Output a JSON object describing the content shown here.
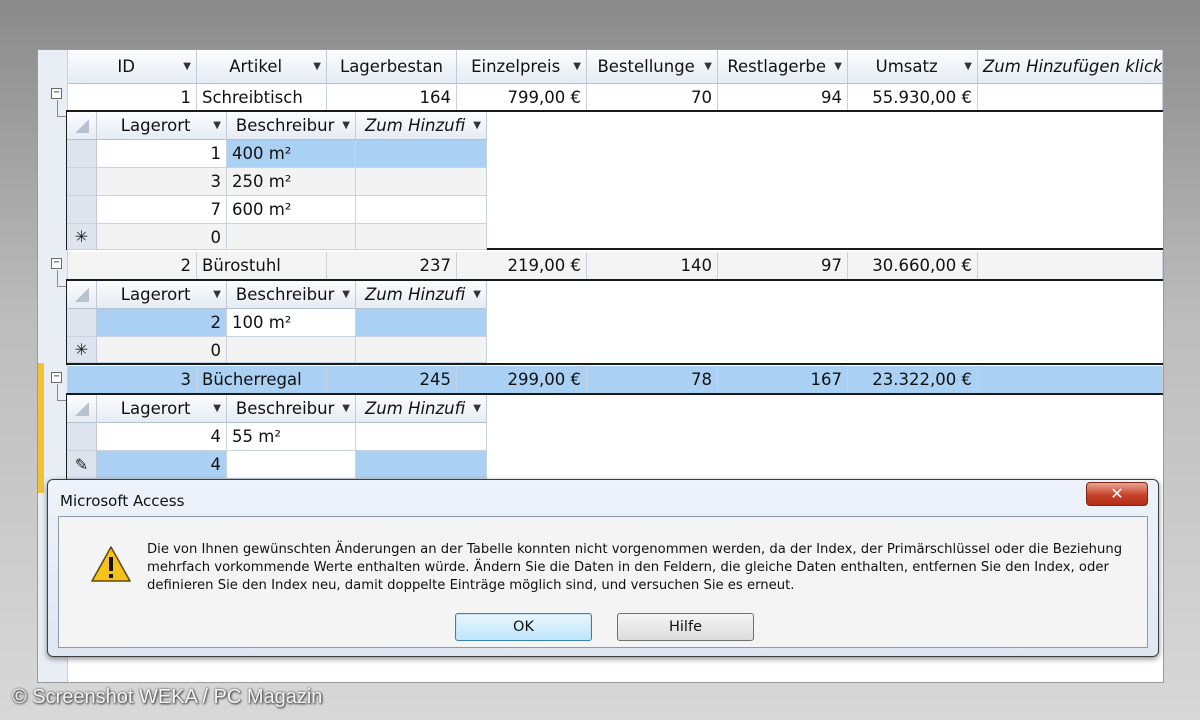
{
  "main": {
    "columns": [
      "ID",
      "Artikel",
      "Lagerbestan",
      "Einzelpreis",
      "Bestellunge",
      "Restlagerbe",
      "Umsatz",
      "Zum Hinzufügen klick"
    ],
    "rows": [
      {
        "id": "1",
        "artikel": "Schreibtisch",
        "lager": "164",
        "preis": "799,00 €",
        "best": "70",
        "rest": "94",
        "umsatz": "55.930,00 €"
      },
      {
        "id": "2",
        "artikel": "Bürostuhl",
        "lager": "237",
        "preis": "219,00 €",
        "best": "140",
        "rest": "97",
        "umsatz": "30.660,00 €"
      },
      {
        "id": "3",
        "artikel": "Bücherregal",
        "lager": "245",
        "preis": "299,00 €",
        "best": "78",
        "rest": "167",
        "umsatz": "23.322,00 €"
      }
    ]
  },
  "sub": {
    "columns": [
      "Lagerort",
      "Beschreibur",
      "Zum Hinzufi"
    ],
    "groups": [
      {
        "rows": [
          {
            "ort": "1",
            "desc": "400 m²"
          },
          {
            "ort": "3",
            "desc": "250 m²"
          },
          {
            "ort": "7",
            "desc": "600 m²"
          },
          {
            "ort": "0",
            "desc": ""
          }
        ]
      },
      {
        "rows": [
          {
            "ort": "2",
            "desc": "100 m²"
          },
          {
            "ort": "0",
            "desc": ""
          }
        ]
      },
      {
        "rows": [
          {
            "ort": "4",
            "desc": "55 m²"
          },
          {
            "ort": "4",
            "desc": ""
          }
        ]
      }
    ],
    "new_row_symbol": "✳",
    "edit_symbol": "✎"
  },
  "dialog": {
    "title": "Microsoft Access",
    "close": "✕",
    "message": "Die von Ihnen gewünschten Änderungen an der Tabelle konnten nicht vorgenommen werden, da der Index, der Primärschlüssel oder die Beziehung mehrfach vorkommende Werte enthalten würde. Ändern Sie die Daten in den Feldern, die gleiche Daten enthalten, entfernen Sie den Index, oder definieren Sie den Index neu, damit doppelte Einträge möglich sind, und versuchen Sie es erneut.",
    "ok": "OK",
    "help": "Hilfe"
  },
  "credit": "© Screenshot WEKA / PC Magazin",
  "colors": {
    "selection": "#aad1f3",
    "accent_bar": "#f1c232",
    "close_red": "#c7422a"
  }
}
